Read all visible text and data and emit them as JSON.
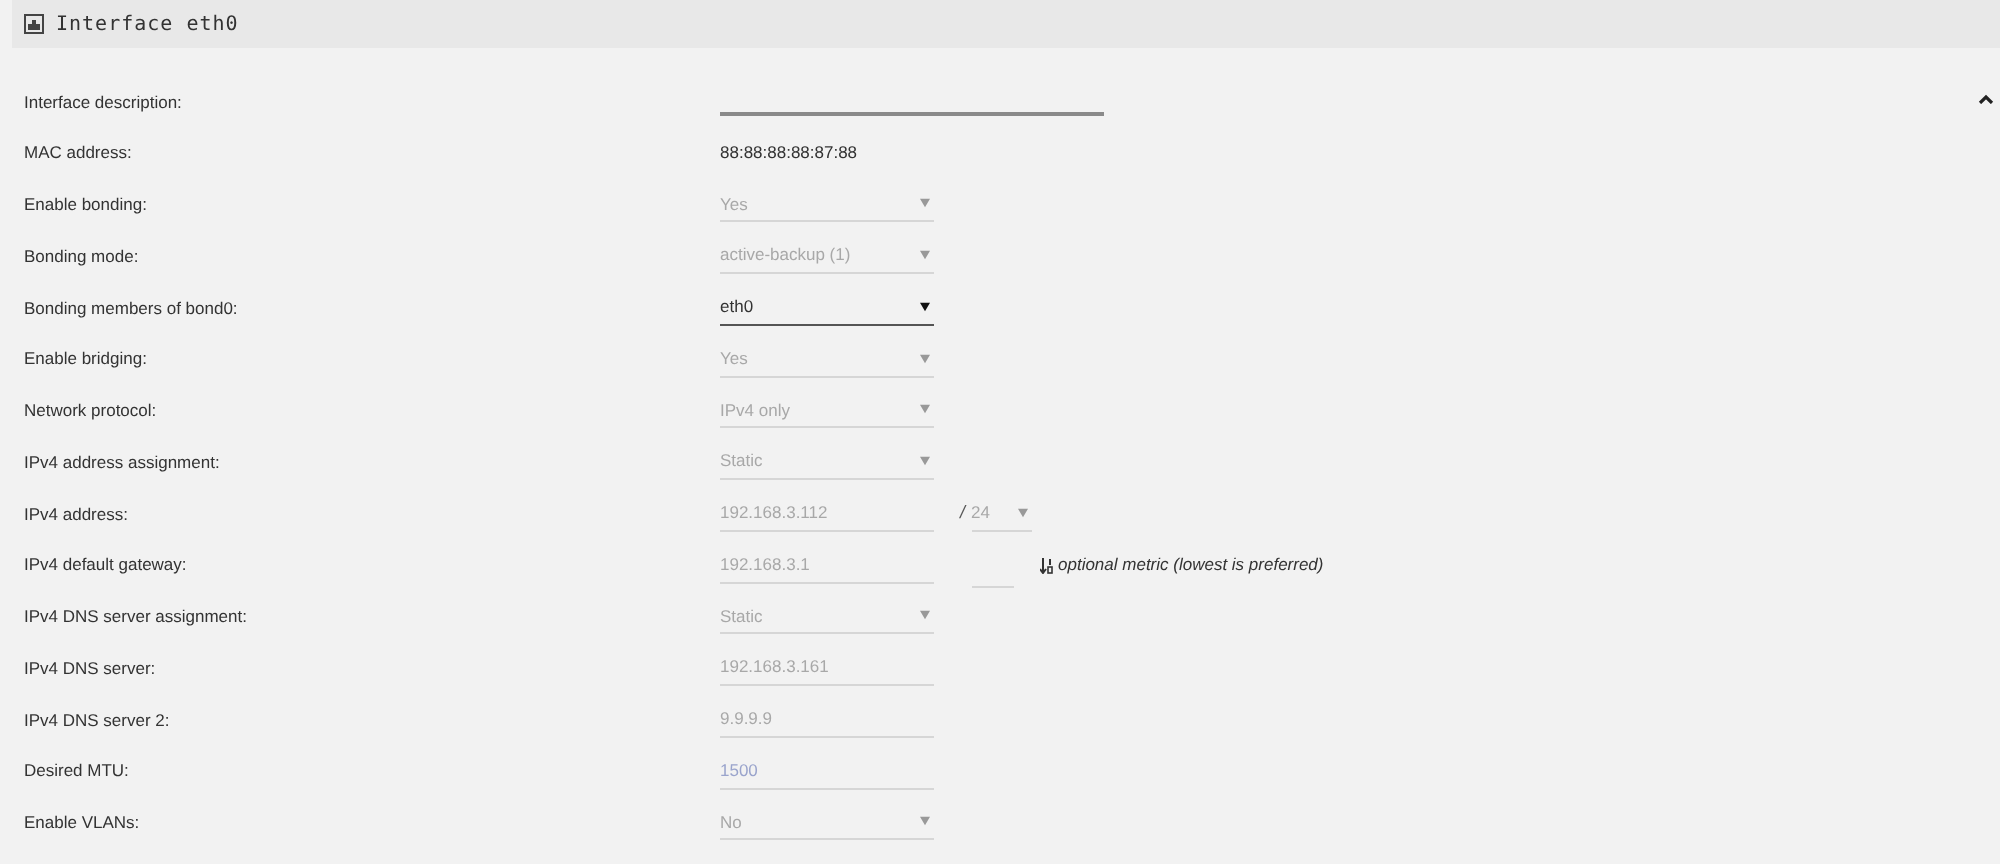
{
  "panel": {
    "title": "Interface eth0",
    "expanded": true
  },
  "rows": [
    {
      "label": "Interface description:",
      "kind": "text"
    },
    {
      "label": "MAC address:",
      "kind": "static",
      "value": "88:88:88:88:87:88"
    },
    {
      "label": "Enable bonding:",
      "kind": "select",
      "value": "Yes",
      "disabled": true
    },
    {
      "label": "Bonding mode:",
      "kind": "select",
      "value": "active-backup (1)",
      "disabled": true
    },
    {
      "label": "Bonding members of bond0:",
      "kind": "select",
      "value": "eth0",
      "disabled": false
    },
    {
      "label": "Enable bridging:",
      "kind": "select",
      "value": "Yes",
      "disabled": true
    },
    {
      "label": "Network protocol:",
      "kind": "select",
      "value": "IPv4 only",
      "disabled": true
    },
    {
      "label": "IPv4 address assignment:",
      "kind": "select",
      "value": "Static",
      "disabled": true
    },
    {
      "label": "IPv4 address:",
      "kind": "address",
      "value": "192.168.3.112",
      "separator": "/",
      "prefix": "24",
      "disabled": true
    },
    {
      "label": "IPv4 default gateway:",
      "kind": "gateway",
      "value": "192.168.3.1",
      "hint": "optional metric (lowest is preferred)",
      "disabled": true
    },
    {
      "label": "IPv4 DNS server assignment:",
      "kind": "select",
      "value": "Static",
      "disabled": true
    },
    {
      "label": "IPv4 DNS server:",
      "kind": "input",
      "value": "192.168.3.161",
      "disabled": true
    },
    {
      "label": "IPv4 DNS server 2:",
      "kind": "input",
      "value": "9.9.9.9",
      "disabled": true
    },
    {
      "label": "Desired MTU:",
      "kind": "input",
      "placeholder": "1500",
      "disabled": true
    },
    {
      "label": "Enable VLANs:",
      "kind": "select",
      "value": "No",
      "disabled": true
    }
  ]
}
